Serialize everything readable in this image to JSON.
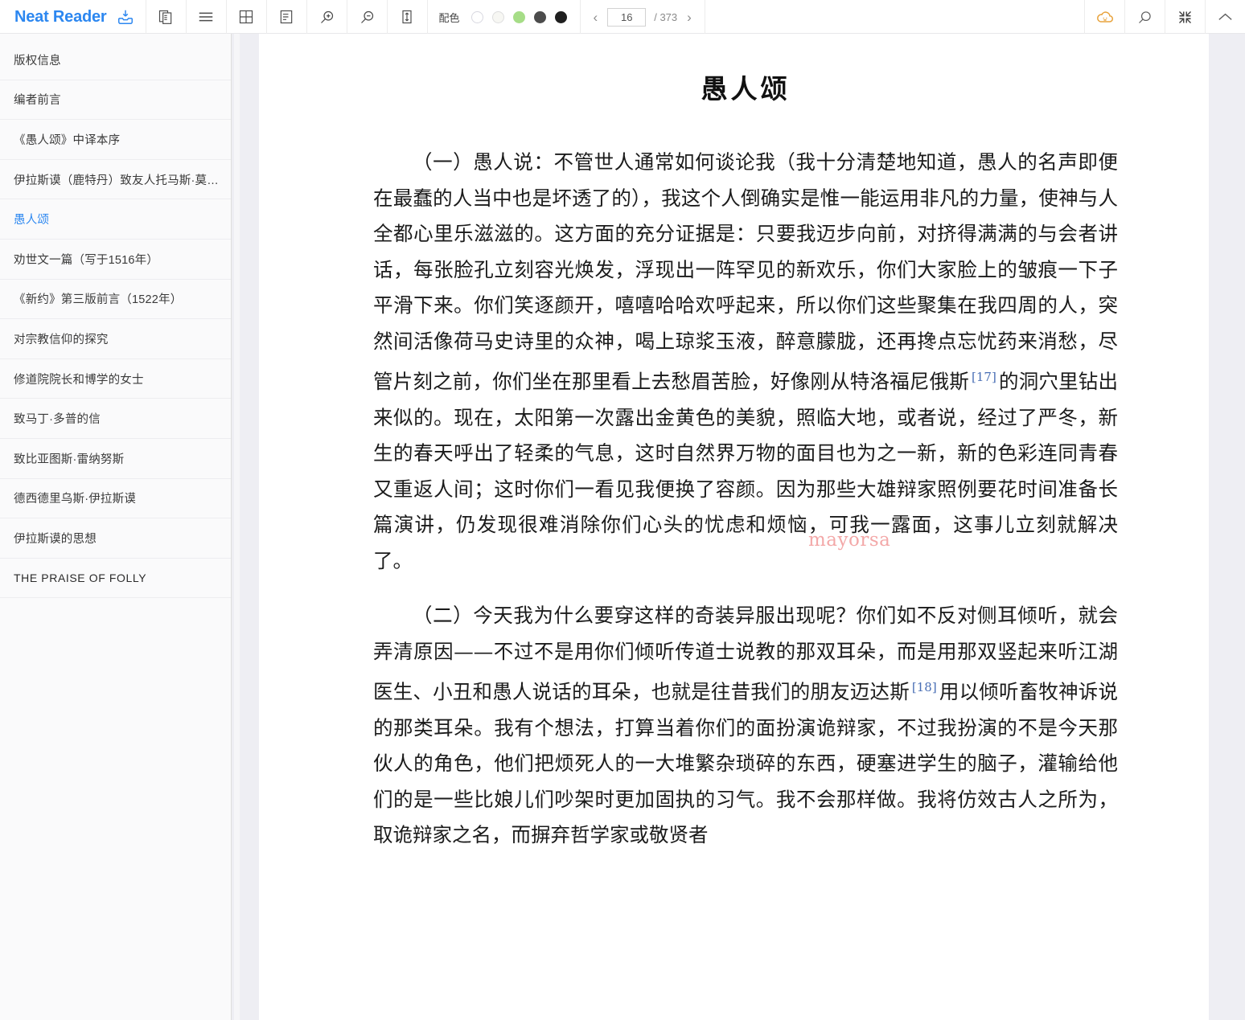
{
  "app": {
    "brand": "Neat Reader",
    "brand_color": "#2c87f0",
    "brand_icon": "download-box-icon"
  },
  "toolbar": {
    "icons": [
      {
        "name": "copy-pages-icon",
        "title": "双页"
      },
      {
        "name": "list-lines-icon",
        "title": "目录"
      },
      {
        "name": "grid-icon",
        "title": "网格"
      },
      {
        "name": "document-outline-icon",
        "title": "笔记"
      },
      {
        "name": "zoom-in-icon",
        "title": "放大"
      },
      {
        "name": "zoom-out-icon",
        "title": "缩小"
      },
      {
        "name": "line-height-icon",
        "title": "行高"
      }
    ],
    "palette": {
      "label": "配色",
      "swatches": [
        {
          "name": "swatch-white",
          "color": "#ffffff",
          "selected": true
        },
        {
          "name": "swatch-paper",
          "color": "#f7f7f3",
          "selected": false
        },
        {
          "name": "swatch-green",
          "color": "#a6dd87",
          "selected": false
        },
        {
          "name": "swatch-dark-gray",
          "color": "#4c4c4c",
          "selected": false
        },
        {
          "name": "swatch-black",
          "color": "#1f1f1f",
          "selected": false
        }
      ]
    },
    "pager": {
      "prev": "‹",
      "next": "›",
      "current_page": "16",
      "total_label": "/ 373",
      "total_pages": 373
    },
    "right_icons": [
      {
        "name": "cloud-sync-icon",
        "color": "#e8a33d"
      },
      {
        "name": "search-icon",
        "color": "#6c6c6c"
      },
      {
        "name": "compress-icon",
        "color": "#4a4a4a"
      },
      {
        "name": "collapse-up-icon",
        "color": "#6c6c6c"
      }
    ]
  },
  "sidebar": {
    "items": [
      {
        "label": "版权信息",
        "active": false,
        "latin": false
      },
      {
        "label": "编者前言",
        "active": false,
        "latin": false
      },
      {
        "label": "《愚人颂》中译本序",
        "active": false,
        "latin": false
      },
      {
        "label": "伊拉斯谟（鹿特丹）致友人托马斯·莫…",
        "active": false,
        "latin": false
      },
      {
        "label": "愚人颂",
        "active": true,
        "latin": false
      },
      {
        "label": "劝世文一篇（写于1516年）",
        "active": false,
        "latin": false
      },
      {
        "label": "《新约》第三版前言（1522年）",
        "active": false,
        "latin": false
      },
      {
        "label": "对宗教信仰的探究",
        "active": false,
        "latin": false
      },
      {
        "label": "修道院院长和博学的女士",
        "active": false,
        "latin": false
      },
      {
        "label": "致马丁·多普的信",
        "active": false,
        "latin": false
      },
      {
        "label": "致比亚图斯·雷纳努斯",
        "active": false,
        "latin": false
      },
      {
        "label": "德西德里乌斯·伊拉斯谟",
        "active": false,
        "latin": false
      },
      {
        "label": "伊拉斯谟的思想",
        "active": false,
        "latin": false
      },
      {
        "label": "THE PRAISE OF FOLLY",
        "active": false,
        "latin": true
      }
    ]
  },
  "content": {
    "title": "愚人颂",
    "watermark": "mayorsa",
    "paragraphs": [
      {
        "id": "para-1",
        "part_a": "（一）愚人说：不管世人通常如何谈论我（我十分清楚地知道，愚人的名声即便在最蠢的人当中也是坏透了的），我这个人倒确实是惟一能运用非凡的力量，使神与人全都心里乐滋滋的。这方面的充分证据是：只要我迈步向前，对挤得满满的与会者讲话，每张脸孔立刻容光焕发，浮现出一阵罕见的新欢乐，你们大家脸上的皱痕一下子平滑下来。你们笑逐颜开，嘻嘻哈哈欢呼起来，所以你们这些聚集在我四周的人，突然间活像荷马史诗里的众神，喝上琼浆玉液，醉意朦胧，还再搀点忘忧药来消愁，尽管片刻之前，你们坐在那里看上去愁眉苦脸，好像刚从特洛福尼俄斯",
        "footnote": "[17]",
        "part_b": "的洞穴里钻出来似的。现在，太阳第一次露出金黄色的美貌，照临大地，或者说，经过了严冬，新生的春天呼出了轻柔的气息，这时自然界万物的面目也为之一新，新的色彩连同青春又重返人间；这时你们一看见我便换了容颜。因为那些大雄辩家照例要花时间准备长篇演讲，仍发现很难消除你们心头的忧虑和烦恼，可我一露面，这事儿立刻就解决了。"
      },
      {
        "id": "para-2",
        "part_a": "（二）今天我为什么要穿这样的奇装异服出现呢？你们如不反对侧耳倾听，就会弄清原因——不过不是用你们倾听传道士说教的那双耳朵，而是用那双竖起来听江湖医生、小丑和愚人说话的耳朵，也就是往昔我们的朋友迈达斯",
        "footnote": "[18]",
        "part_b": "用以倾听畜牧神诉说的那类耳朵。我有个想法，打算当着你们的面扮演诡辩家，不过我扮演的不是今天那伙人的角色，他们把烦死人的一大堆繁杂琐碎的东西，硬塞进学生的脑子，灌输给他们的是一些比娘儿们吵架时更加固执的习气。我不会那样做。我将仿效古人之所为，取诡辩家之名，而摒弃哲学家或敬贤者"
      }
    ]
  }
}
